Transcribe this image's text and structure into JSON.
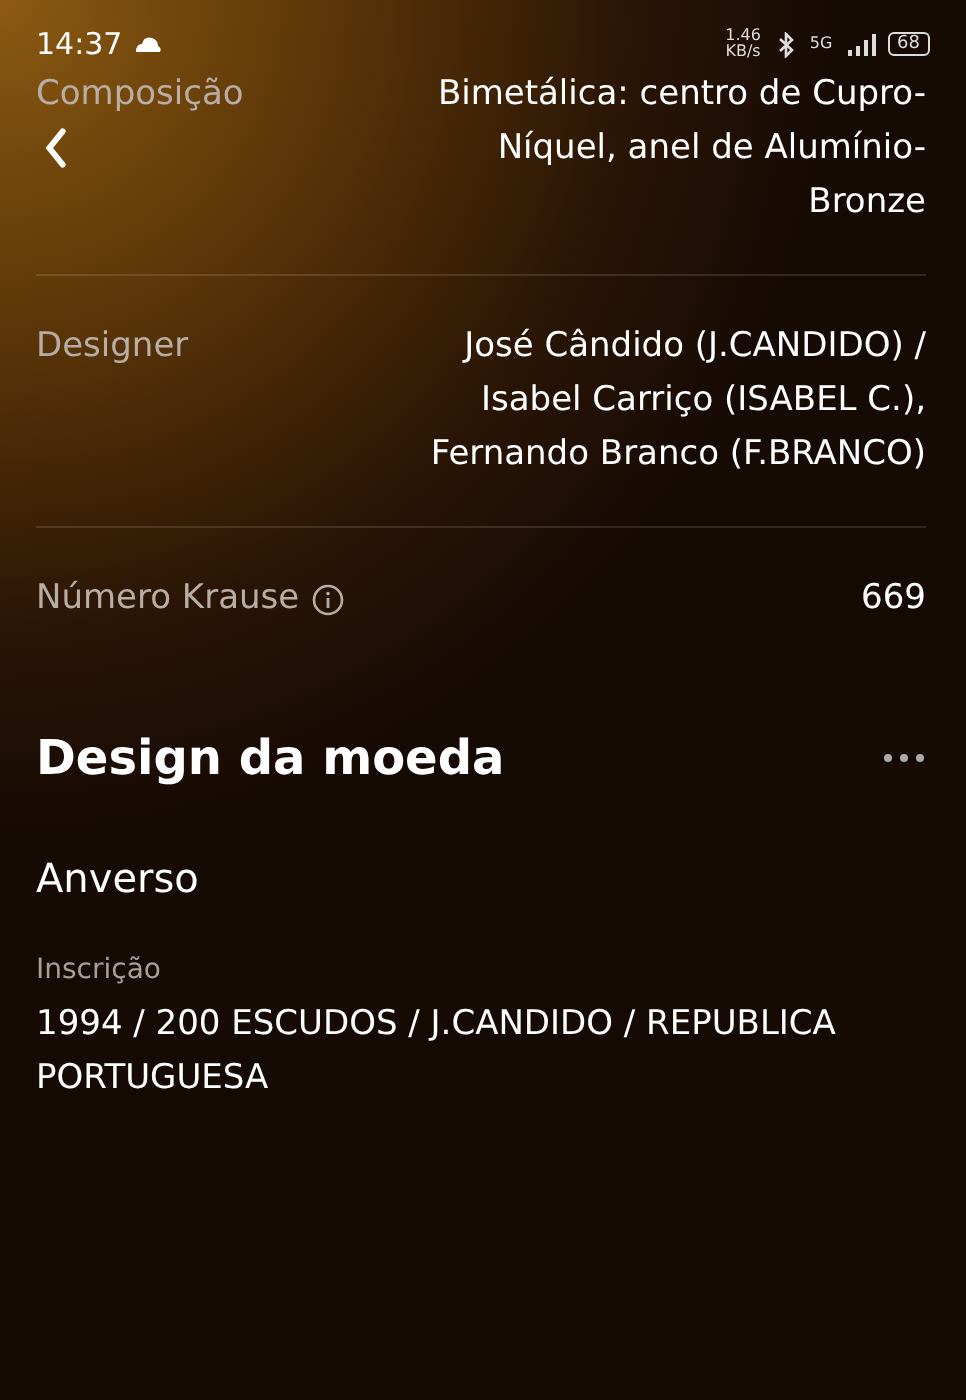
{
  "status_bar": {
    "time": "14:37",
    "net_speed": "1.46 KB/s",
    "network": "5G",
    "battery": "68"
  },
  "details": [
    {
      "label": "Composição",
      "value": "Bimetálica: centro de Cupro-Níquel, anel de Alumínio-Bronze",
      "info": false
    },
    {
      "label": "Designer",
      "value": "José Cândido (J.CANDIDO) / Isabel Carriço (ISABEL C.), Fernando Branco (F.BRANCO)",
      "info": false
    },
    {
      "label": "Número Krause",
      "value": "669",
      "info": true
    }
  ],
  "section": {
    "title": "Design da moeda",
    "side": "Anverso",
    "fields": [
      {
        "label": "Inscrição",
        "value": "1994 / 200 ESCUDOS / J.CANDIDO / REPUBLICA PORTUGUESA"
      }
    ]
  }
}
